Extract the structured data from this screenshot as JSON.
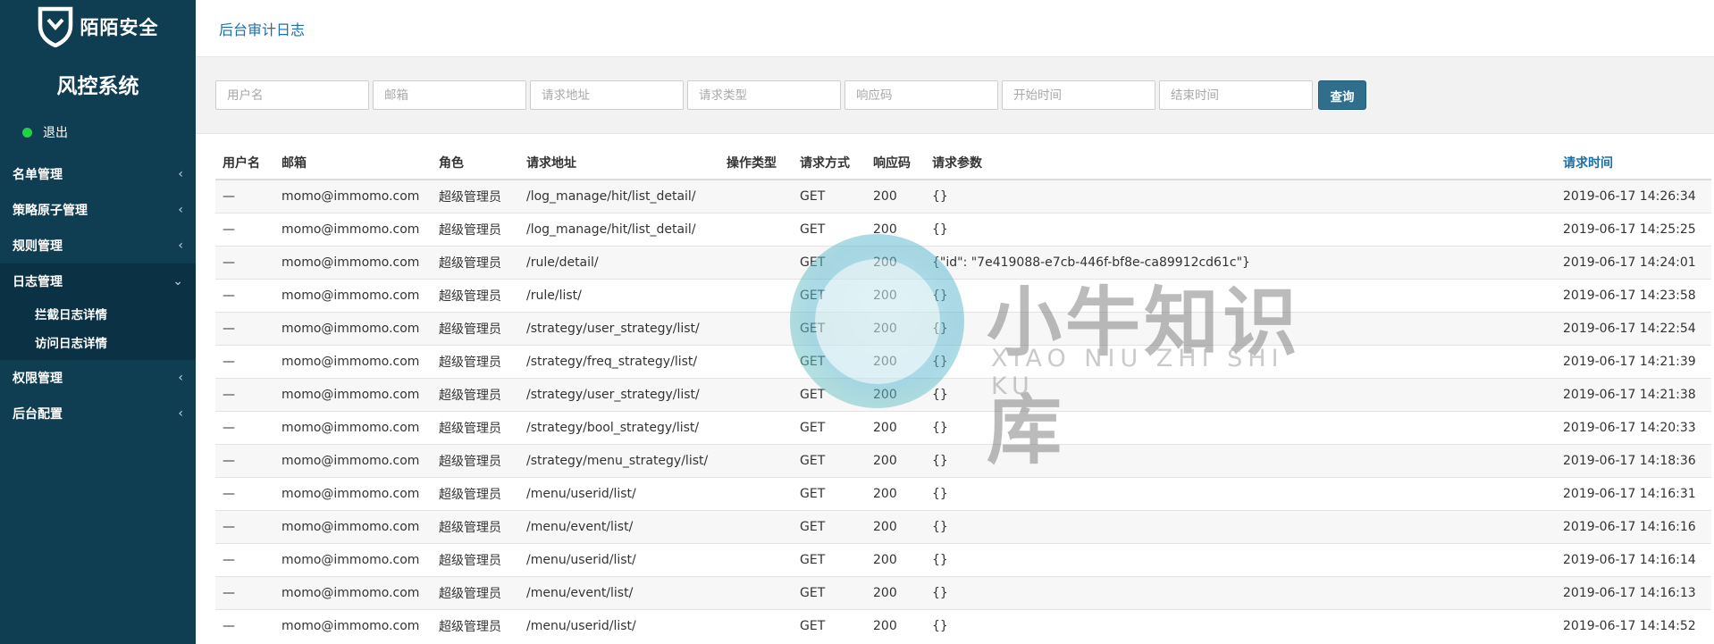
{
  "brand": {
    "name": "陌陌安全",
    "system_title": "风控系统",
    "accent": "#0f3d52"
  },
  "user": {
    "logout_label": "退出",
    "status_color": "#22d340"
  },
  "sidebar": {
    "items": [
      {
        "label": "名单管理"
      },
      {
        "label": "策略原子管理"
      },
      {
        "label": "规则管理"
      },
      {
        "label": "日志管理",
        "submenu": [
          {
            "label": "拦截日志详情"
          },
          {
            "label": "访问日志详情"
          }
        ]
      },
      {
        "label": "权限管理"
      },
      {
        "label": "后台配置"
      }
    ]
  },
  "header": {
    "title": "后台审计日志"
  },
  "filters": {
    "username": "用户名",
    "email": "邮箱",
    "request_url": "请求地址",
    "request_type": "请求类型",
    "status_code": "响应码",
    "start_time": "开始时间",
    "end_time": "结束时间",
    "query_label": "查询"
  },
  "table": {
    "headers": [
      "用户名",
      "邮箱",
      "角色",
      "请求地址",
      "操作类型",
      "请求方式",
      "响应码",
      "请求参数",
      "请求时间"
    ],
    "rows": [
      [
        "—",
        "momo@immomo.com",
        "超级管理员",
        "/log_manage/hit/list_detail/",
        "",
        "GET",
        "200",
        "{}",
        "2019-06-17 14:26:34"
      ],
      [
        "—",
        "momo@immomo.com",
        "超级管理员",
        "/log_manage/hit/list_detail/",
        "",
        "GET",
        "200",
        "{}",
        "2019-06-17 14:25:25"
      ],
      [
        "—",
        "momo@immomo.com",
        "超级管理员",
        "/rule/detail/",
        "",
        "GET",
        "200",
        "{\"id\": \"7e419088-e7cb-446f-bf8e-ca89912cd61c\"}",
        "2019-06-17 14:24:01"
      ],
      [
        "—",
        "momo@immomo.com",
        "超级管理员",
        "/rule/list/",
        "",
        "GET",
        "200",
        "{}",
        "2019-06-17 14:23:58"
      ],
      [
        "—",
        "momo@immomo.com",
        "超级管理员",
        "/strategy/user_strategy/list/",
        "",
        "GET",
        "200",
        "{}",
        "2019-06-17 14:22:54"
      ],
      [
        "—",
        "momo@immomo.com",
        "超级管理员",
        "/strategy/freq_strategy/list/",
        "",
        "GET",
        "200",
        "{}",
        "2019-06-17 14:21:39"
      ],
      [
        "—",
        "momo@immomo.com",
        "超级管理员",
        "/strategy/user_strategy/list/",
        "",
        "GET",
        "200",
        "{}",
        "2019-06-17 14:21:38"
      ],
      [
        "—",
        "momo@immomo.com",
        "超级管理员",
        "/strategy/bool_strategy/list/",
        "",
        "GET",
        "200",
        "{}",
        "2019-06-17 14:20:33"
      ],
      [
        "—",
        "momo@immomo.com",
        "超级管理员",
        "/strategy/menu_strategy/list/",
        "",
        "GET",
        "200",
        "{}",
        "2019-06-17 14:18:36"
      ],
      [
        "—",
        "momo@immomo.com",
        "超级管理员",
        "/menu/userid/list/",
        "",
        "GET",
        "200",
        "{}",
        "2019-06-17 14:16:31"
      ],
      [
        "—",
        "momo@immomo.com",
        "超级管理员",
        "/menu/event/list/",
        "",
        "GET",
        "200",
        "{}",
        "2019-06-17 14:16:16"
      ],
      [
        "—",
        "momo@immomo.com",
        "超级管理员",
        "/menu/userid/list/",
        "",
        "GET",
        "200",
        "{}",
        "2019-06-17 14:16:14"
      ],
      [
        "—",
        "momo@immomo.com",
        "超级管理员",
        "/menu/event/list/",
        "",
        "GET",
        "200",
        "{}",
        "2019-06-17 14:16:13"
      ],
      [
        "—",
        "momo@immomo.com",
        "超级管理员",
        "/menu/userid/list/",
        "",
        "GET",
        "200",
        "{}",
        "2019-06-17 14:14:52"
      ]
    ]
  },
  "watermark": {
    "text": "小牛知识库",
    "sub": "XIAO NIU ZHI SHI KU"
  }
}
